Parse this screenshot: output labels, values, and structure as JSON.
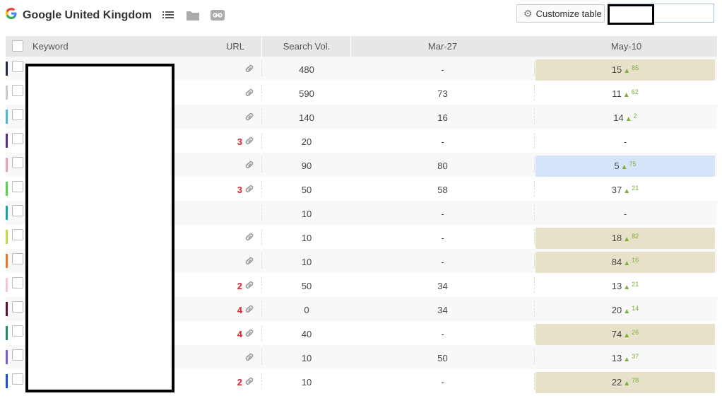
{
  "toolbar": {
    "title": "Google United Kingdom",
    "customize_label": "Customize table",
    "search_value": ""
  },
  "header": {
    "keyword": "Keyword",
    "url": "URL",
    "search_vol": "Search Vol.",
    "date1": "Mar-27",
    "date2": "May-10"
  },
  "colors": {
    "accent_up": "#7cae3a",
    "url_count": "#d9252a",
    "highlight_tan": "#e8e1c9",
    "highlight_blue": "#d5e4f9"
  },
  "rows": [
    {
      "color": "#1f2a44",
      "url_count": "",
      "link": true,
      "vol": "480",
      "mar": "-",
      "may": "15",
      "delta": "85",
      "hl": "tan"
    },
    {
      "color": "#c9c9c9",
      "url_count": "",
      "link": true,
      "vol": "590",
      "mar": "73",
      "may": "11",
      "delta": "62",
      "hl": ""
    },
    {
      "color": "#4fb7d3",
      "url_count": "",
      "link": true,
      "vol": "140",
      "mar": "16",
      "may": "14",
      "delta": "2",
      "hl": ""
    },
    {
      "color": "#5b2c8a",
      "url_count": "3",
      "link": true,
      "vol": "20",
      "mar": "-",
      "may": "-",
      "delta": "",
      "hl": ""
    },
    {
      "color": "#e9a0b8",
      "url_count": "",
      "link": true,
      "vol": "90",
      "mar": "80",
      "may": "5",
      "delta": "75",
      "hl": "blue"
    },
    {
      "color": "#5ad14a",
      "url_count": "3",
      "link": true,
      "vol": "50",
      "mar": "58",
      "may": "37",
      "delta": "21",
      "hl": ""
    },
    {
      "color": "#1aa3a3",
      "url_count": "",
      "link": false,
      "vol": "10",
      "mar": "-",
      "may": "-",
      "delta": "",
      "hl": ""
    },
    {
      "color": "#c2d64a",
      "url_count": "",
      "link": true,
      "vol": "10",
      "mar": "-",
      "may": "18",
      "delta": "82",
      "hl": "tan"
    },
    {
      "color": "#e07a2e",
      "url_count": "",
      "link": true,
      "vol": "10",
      "mar": "-",
      "may": "84",
      "delta": "16",
      "hl": "tan"
    },
    {
      "color": "#f5c6d2",
      "url_count": "2",
      "link": true,
      "vol": "50",
      "mar": "34",
      "may": "13",
      "delta": "21",
      "hl": ""
    },
    {
      "color": "#5a1238",
      "url_count": "4",
      "link": true,
      "vol": "0",
      "mar": "34",
      "may": "20",
      "delta": "14",
      "hl": ""
    },
    {
      "color": "#1f8a6a",
      "url_count": "4",
      "link": true,
      "vol": "40",
      "mar": "-",
      "may": "74",
      "delta": "26",
      "hl": "tan"
    },
    {
      "color": "#7a5cc4",
      "url_count": "",
      "link": true,
      "vol": "10",
      "mar": "50",
      "may": "13",
      "delta": "37",
      "hl": ""
    },
    {
      "color": "#1f4fd1",
      "url_count": "2",
      "link": true,
      "vol": "10",
      "mar": "-",
      "may": "22",
      "delta": "78",
      "hl": "tan"
    }
  ]
}
